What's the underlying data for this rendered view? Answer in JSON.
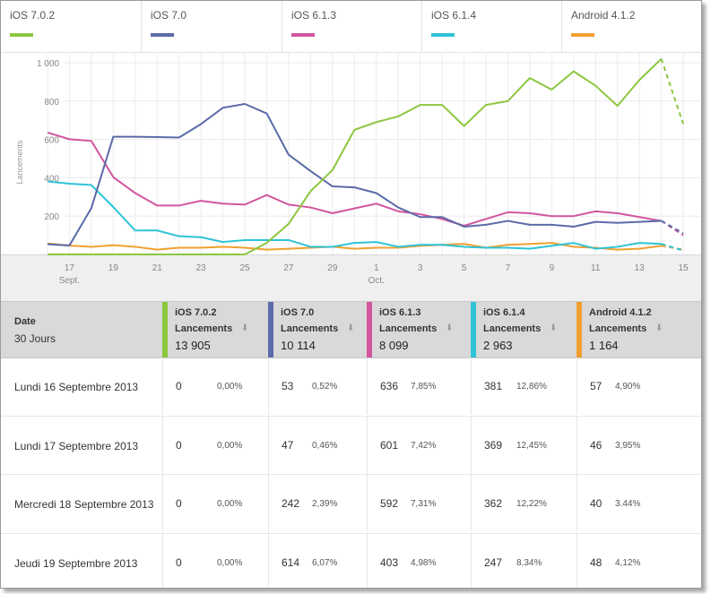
{
  "legend": [
    {
      "label": "iOS 7.0.2",
      "color": "#8cc63f"
    },
    {
      "label": "iOS 7.0",
      "color": "#5b6aa8"
    },
    {
      "label": "iOS 6.1.3",
      "color": "#d2559e"
    },
    {
      "label": "iOS 6.1.4",
      "color": "#2ec3d6"
    },
    {
      "label": "Android 4.1.2",
      "color": "#f0a030"
    }
  ],
  "chart_data": {
    "type": "line",
    "ylabel": "Lancements",
    "yticks": [
      "1 000",
      "800",
      "600",
      "400",
      "200"
    ],
    "ylim": [
      0,
      1000
    ],
    "x_ticks": [
      {
        "label": "17",
        "sub": "Sept.",
        "day": 17
      },
      {
        "label": "19",
        "day": 19
      },
      {
        "label": "21",
        "day": 21
      },
      {
        "label": "23",
        "day": 23
      },
      {
        "label": "25",
        "day": 25
      },
      {
        "label": "27",
        "day": 27
      },
      {
        "label": "29",
        "day": 29
      },
      {
        "label": "1",
        "sub": "Oct.",
        "day": 31
      },
      {
        "label": "3",
        "day": 33
      },
      {
        "label": "5",
        "day": 35
      },
      {
        "label": "7",
        "day": 37
      },
      {
        "label": "9",
        "day": 39
      },
      {
        "label": "11",
        "day": 41
      },
      {
        "label": "13",
        "day": 43
      },
      {
        "label": "15",
        "day": 45
      }
    ],
    "x_days": [
      16,
      17,
      18,
      19,
      20,
      21,
      22,
      23,
      24,
      25,
      26,
      27,
      28,
      29,
      30,
      31,
      32,
      33,
      34,
      35,
      36,
      37,
      38,
      39,
      40,
      41,
      42,
      43,
      44,
      45
    ],
    "series": [
      {
        "name": "iOS 7.0.2",
        "values": [
          0,
          0,
          0,
          0,
          0,
          0,
          0,
          0,
          0,
          0,
          60,
          160,
          330,
          440,
          650,
          690,
          720,
          780,
          780,
          670,
          780,
          800,
          920,
          860,
          955,
          880,
          775,
          910,
          1020,
          680
        ],
        "dashed_last": true
      },
      {
        "name": "iOS 7.0",
        "values": [
          53,
          47,
          242,
          614,
          614,
          612,
          610,
          680,
          765,
          785,
          735,
          520,
          435,
          355,
          350,
          320,
          245,
          195,
          195,
          145,
          155,
          175,
          155,
          155,
          145,
          170,
          165,
          170,
          175,
          110
        ],
        "dashed_last": true
      },
      {
        "name": "iOS 6.1.3",
        "values": [
          636,
          601,
          592,
          403,
          320,
          255,
          255,
          280,
          265,
          260,
          310,
          260,
          245,
          215,
          240,
          265,
          225,
          210,
          185,
          150,
          185,
          220,
          215,
          200,
          200,
          225,
          215,
          195,
          175,
          100
        ],
        "dashed_last": true
      },
      {
        "name": "iOS 6.1.4",
        "values": [
          381,
          369,
          362,
          247,
          125,
          125,
          95,
          90,
          65,
          75,
          75,
          75,
          40,
          40,
          60,
          65,
          40,
          50,
          50,
          40,
          35,
          35,
          30,
          45,
          60,
          30,
          40,
          60,
          55,
          20
        ],
        "dashed_last": true
      },
      {
        "name": "Android 4.1.2",
        "values": [
          57,
          46,
          40,
          48,
          40,
          25,
          35,
          35,
          40,
          35,
          25,
          30,
          35,
          40,
          30,
          35,
          35,
          45,
          50,
          55,
          35,
          50,
          55,
          60,
          40,
          35,
          25,
          30,
          45,
          25
        ],
        "dashed_last": true
      }
    ]
  },
  "table": {
    "date_header": "Date",
    "date_sub": "30 Jours",
    "metric": "Lancements",
    "columns": [
      {
        "name": "iOS 7.0.2",
        "total": "13 905",
        "color": "#8cc63f"
      },
      {
        "name": "iOS 7.0",
        "total": "10 114",
        "color": "#5b6aa8"
      },
      {
        "name": "iOS 6.1.3",
        "total": "8 099",
        "color": "#d2559e"
      },
      {
        "name": "iOS 6.1.4",
        "total": "2 963",
        "color": "#2ec3d6"
      },
      {
        "name": "Android 4.1.2",
        "total": "1 164",
        "color": "#f0a030"
      }
    ],
    "rows": [
      {
        "date": "Lundi 16 Septembre 2013",
        "cells": [
          [
            "0",
            "0,00%"
          ],
          [
            "53",
            "0,52%"
          ],
          [
            "636",
            "7,85%"
          ],
          [
            "381",
            "12,86%"
          ],
          [
            "57",
            "4,90%"
          ]
        ]
      },
      {
        "date": "Lundi 17 Septembre 2013",
        "cells": [
          [
            "0",
            "0,00%"
          ],
          [
            "47",
            "0,46%"
          ],
          [
            "601",
            "7,42%"
          ],
          [
            "369",
            "12,45%"
          ],
          [
            "46",
            "3,95%"
          ]
        ]
      },
      {
        "date": "Mercredi 18 Septembre 2013",
        "cells": [
          [
            "0",
            "0,00%"
          ],
          [
            "242",
            "2,39%"
          ],
          [
            "592",
            "7,31%"
          ],
          [
            "362",
            "12,22%"
          ],
          [
            "40",
            "3.44%"
          ]
        ]
      },
      {
        "date": "Jeudi 19 Septembre 2013",
        "cells": [
          [
            "0",
            "0,00%"
          ],
          [
            "614",
            "6,07%"
          ],
          [
            "403",
            "4,98%"
          ],
          [
            "247",
            "8,34%"
          ],
          [
            "48",
            "4,12%"
          ]
        ]
      }
    ]
  }
}
